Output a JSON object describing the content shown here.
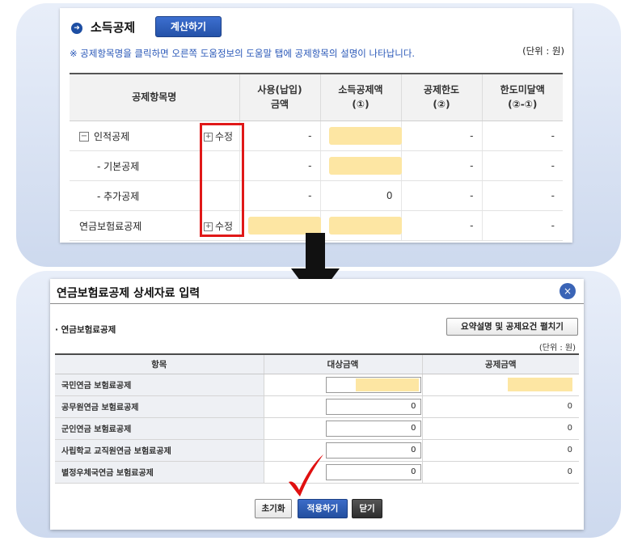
{
  "colors": {
    "accent_blue": "#2452a8",
    "highlight_yellow": "#fde6a3",
    "annotation_red": "#e01818",
    "panel_background": "#dce5f4"
  },
  "deduction": {
    "title": "소득공제",
    "calc_button": "계산하기",
    "notice": "※ 공제항목명을 클릭하면 오른쪽 도움정보의 도움말 탭에 공제항목의 설명이 나타납니다.",
    "unit": "(단위 : 원)",
    "headers": [
      "공제항목명",
      "사용(납입) 금액",
      "소득공제액 (①)",
      "공제한도 (②)",
      "한도미달액 (②-①)"
    ],
    "header_lines": [
      [
        "공제항목명"
      ],
      [
        "사용(납입)",
        "금액"
      ],
      [
        "소득공제액",
        "(①)"
      ],
      [
        "공제한도",
        "(②)"
      ],
      [
        "한도미달액",
        "(②-①)"
      ]
    ],
    "rows": [
      {
        "name": "인적공제",
        "toggle": "−",
        "edit": "수정",
        "usage": "-",
        "deduction": "",
        "limit": "-",
        "shortfall": "-"
      },
      {
        "name": "- 기본공제",
        "toggle": "",
        "edit": "",
        "usage": "-",
        "deduction": "",
        "limit": "-",
        "shortfall": "-"
      },
      {
        "name": "- 추가공제",
        "toggle": "",
        "edit": "",
        "usage": "-",
        "deduction": "0",
        "limit": "-",
        "shortfall": "-"
      },
      {
        "name": "연금보험료공제",
        "toggle": "",
        "edit": "수정",
        "usage": "",
        "deduction": "",
        "limit": "-",
        "shortfall": "-"
      }
    ]
  },
  "dialog": {
    "title": "연금보험료공제 상세자료 입력",
    "close_icon": "×",
    "section_title": "· 연금보험료공제",
    "expand_button": "요약설명 및 공제요건 펼치기",
    "unit": "(단위 : 원)",
    "headers": [
      "항목",
      "대상금액",
      "공제금액"
    ],
    "rows": [
      {
        "label": "국민연금 보험료공제",
        "target": "",
        "deduction": ""
      },
      {
        "label": "공무원연금 보험료공제",
        "target": "0",
        "deduction": "0"
      },
      {
        "label": "군인연금 보험료공제",
        "target": "0",
        "deduction": "0"
      },
      {
        "label": "사립학교 교직원연금 보험료공제",
        "target": "0",
        "deduction": "0"
      },
      {
        "label": "별정우체국연금 보험료공제",
        "target": "0",
        "deduction": "0"
      }
    ],
    "buttons": {
      "reset": "초기화",
      "apply": "적용하기",
      "close": "닫기"
    }
  }
}
